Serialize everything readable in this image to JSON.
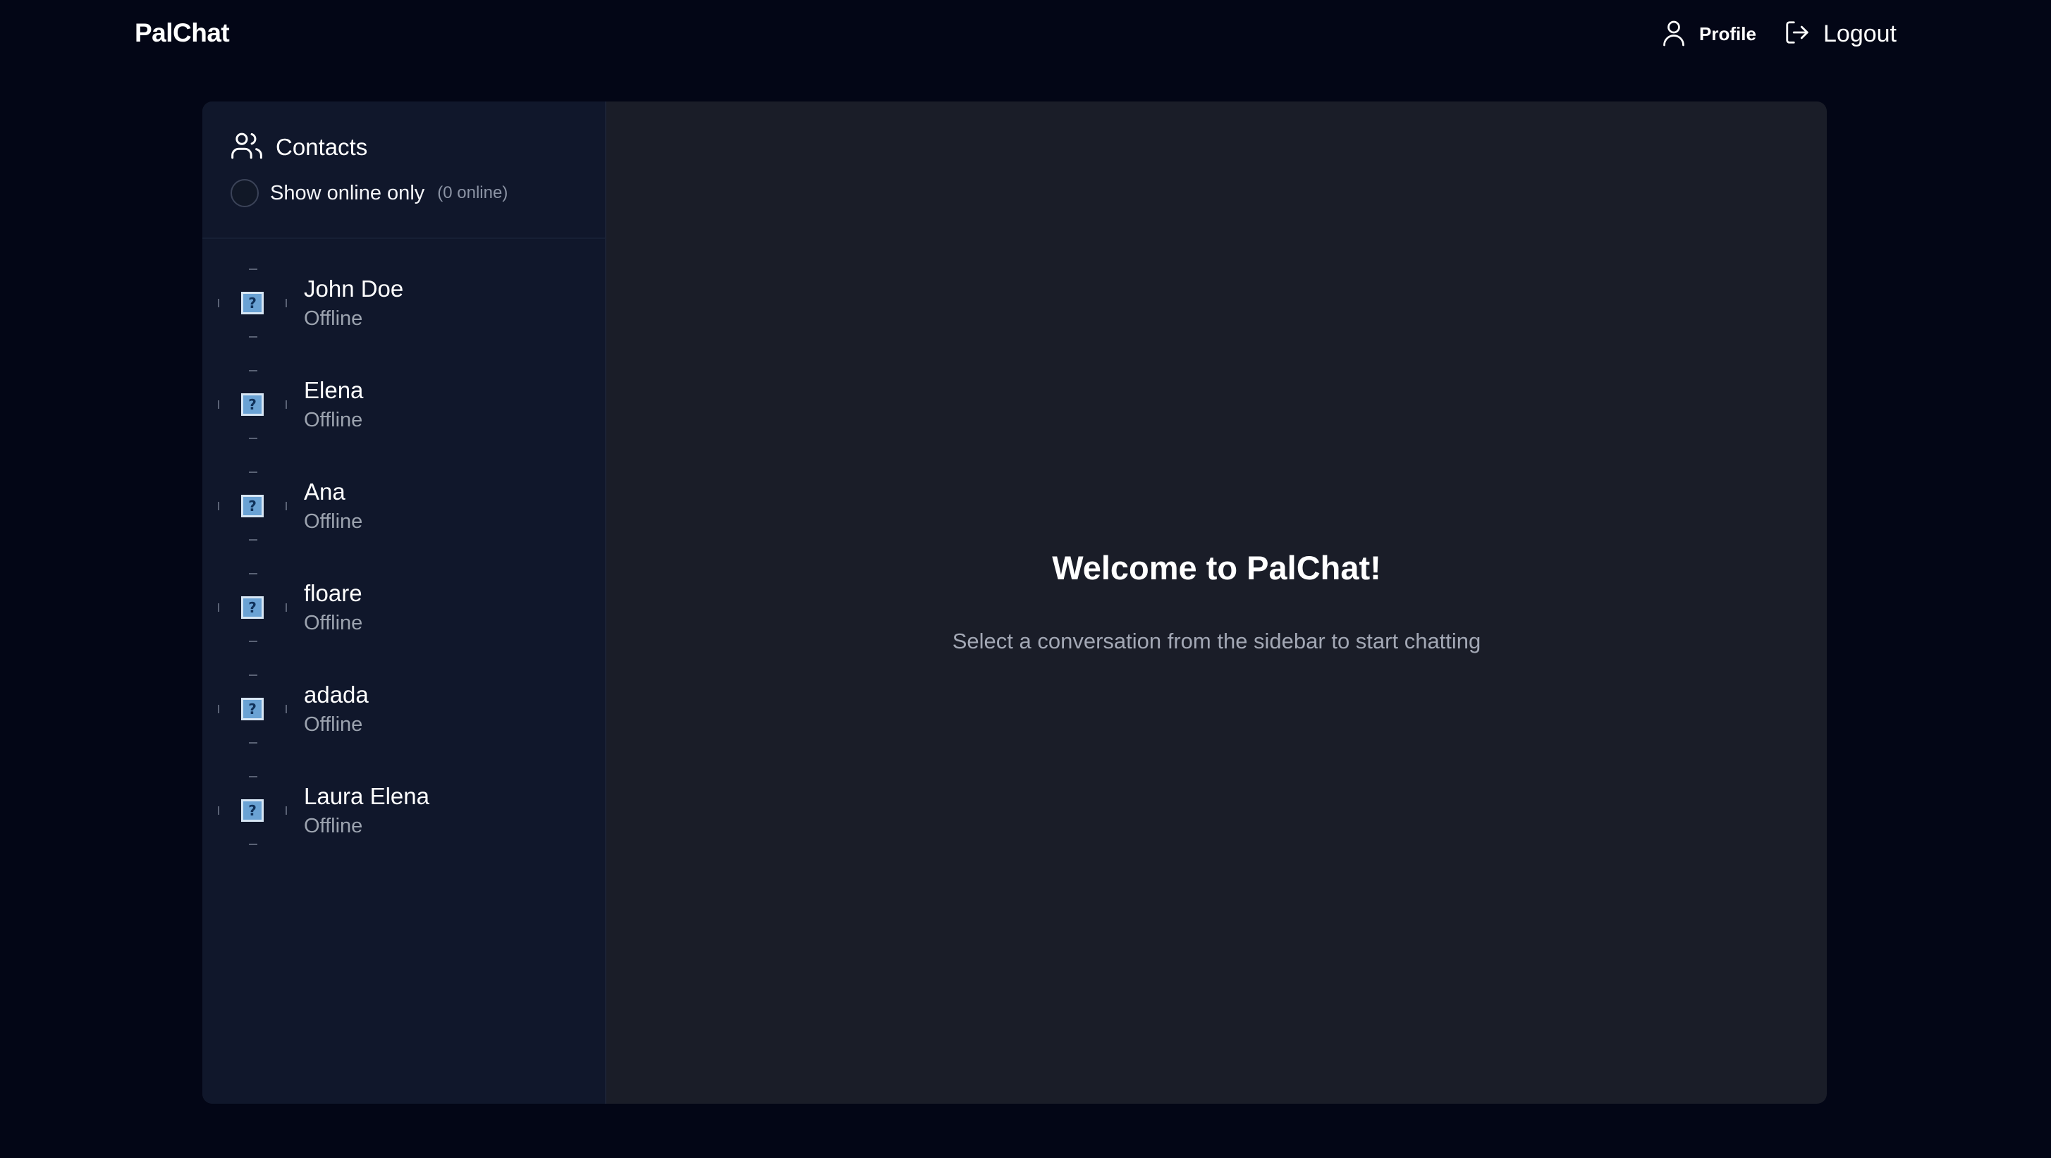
{
  "nav": {
    "brand": "PalChat",
    "profile_label": "Profile",
    "logout_label": "Logout"
  },
  "sidebar": {
    "title": "Contacts",
    "filter": {
      "label": "Show online only",
      "count_text": "(0 online)",
      "checked": false
    },
    "contacts": [
      {
        "name": "John Doe",
        "status": "Offline"
      },
      {
        "name": "Elena",
        "status": "Offline"
      },
      {
        "name": "Ana",
        "status": "Offline"
      },
      {
        "name": "floare",
        "status": "Offline"
      },
      {
        "name": "adada",
        "status": "Offline"
      },
      {
        "name": "Laura Elena",
        "status": "Offline"
      }
    ]
  },
  "main": {
    "welcome_title": "Welcome to PalChat!",
    "welcome_subtitle": "Select a conversation from the sidebar to start chatting"
  },
  "icons": {
    "profile": "user-icon",
    "logout": "logout-icon",
    "contacts": "users-icon",
    "avatar": "broken-image-icon"
  },
  "colors": {
    "page_bg": "#030616",
    "sidebar_bg": "#10172b",
    "panel_bg": "#1a1d28",
    "muted_text": "#9ca3af"
  }
}
